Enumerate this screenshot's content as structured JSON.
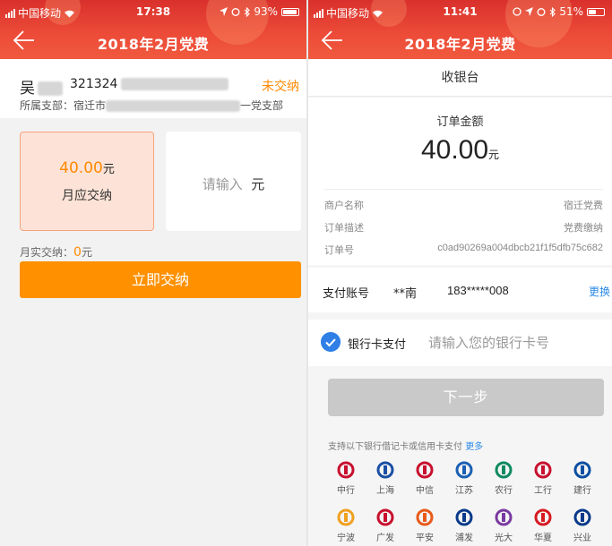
{
  "left": {
    "status": {
      "carrier": "中国移动",
      "time": "17:38",
      "battery": "93%",
      "battery_level": 0.93
    },
    "nav": {
      "title": "2018年2月党费"
    },
    "user": {
      "name": "吴",
      "id": "321324",
      "status": "未交纳",
      "branch_label": "所属支部：宿迁市",
      "branch_suffix": "一党支部"
    },
    "monthly": {
      "amount": "40.00",
      "unit": "元",
      "label": "月应交纳"
    },
    "custom": {
      "placeholder": "请输入",
      "unit": "元"
    },
    "actual": {
      "label": "月实交纳：",
      "value": "0",
      "unit": "元"
    },
    "pay_button": "立即交纳"
  },
  "right": {
    "status": {
      "carrier": "中国移动",
      "time": "11:41",
      "battery": "51%",
      "battery_level": 0.51
    },
    "nav": {
      "title": "2018年2月党费"
    },
    "cashier_title": "收银台",
    "order": {
      "label": "订单金额",
      "amount": "40.00",
      "unit": "元",
      "rows": [
        {
          "key": "商户名称",
          "value": "宿迁党费"
        },
        {
          "key": "订单描述",
          "value": "党费缴纳"
        },
        {
          "key": "订单号",
          "value": "c0ad90269a004dbcb21f1f5dfb75c682"
        }
      ]
    },
    "account": {
      "label": "支付账号",
      "name": "**南",
      "phone": "183*****008",
      "change": "更换"
    },
    "bank_pay": {
      "label": "银行卡支付",
      "placeholder": "请输入您的银行卡号"
    },
    "next_button": "下一步",
    "support": {
      "text": "支持以下银行借记卡或信用卡支付",
      "more": "更多"
    },
    "banks": [
      {
        "name": "中行",
        "color": "#c8102e"
      },
      {
        "name": "上海",
        "color": "#1a4fa3"
      },
      {
        "name": "中信",
        "color": "#c8102e"
      },
      {
        "name": "江苏",
        "color": "#1a5fb4"
      },
      {
        "name": "农行",
        "color": "#0f8a5f"
      },
      {
        "name": "工行",
        "color": "#c8102e"
      },
      {
        "name": "建行",
        "color": "#0a4ea2"
      },
      {
        "name": "宁波",
        "color": "#f0a020"
      },
      {
        "name": "广发",
        "color": "#c8102e"
      },
      {
        "name": "平安",
        "color": "#e85a1a"
      },
      {
        "name": "浦发",
        "color": "#0a3a8a"
      },
      {
        "name": "光大",
        "color": "#7a3aa0"
      },
      {
        "name": "华夏",
        "color": "#d71920"
      },
      {
        "name": "兴业",
        "color": "#0a3a8a"
      }
    ],
    "colors": {
      "accent": "#ff9100",
      "link": "#2b8ae8",
      "header": "#e8402f"
    }
  }
}
